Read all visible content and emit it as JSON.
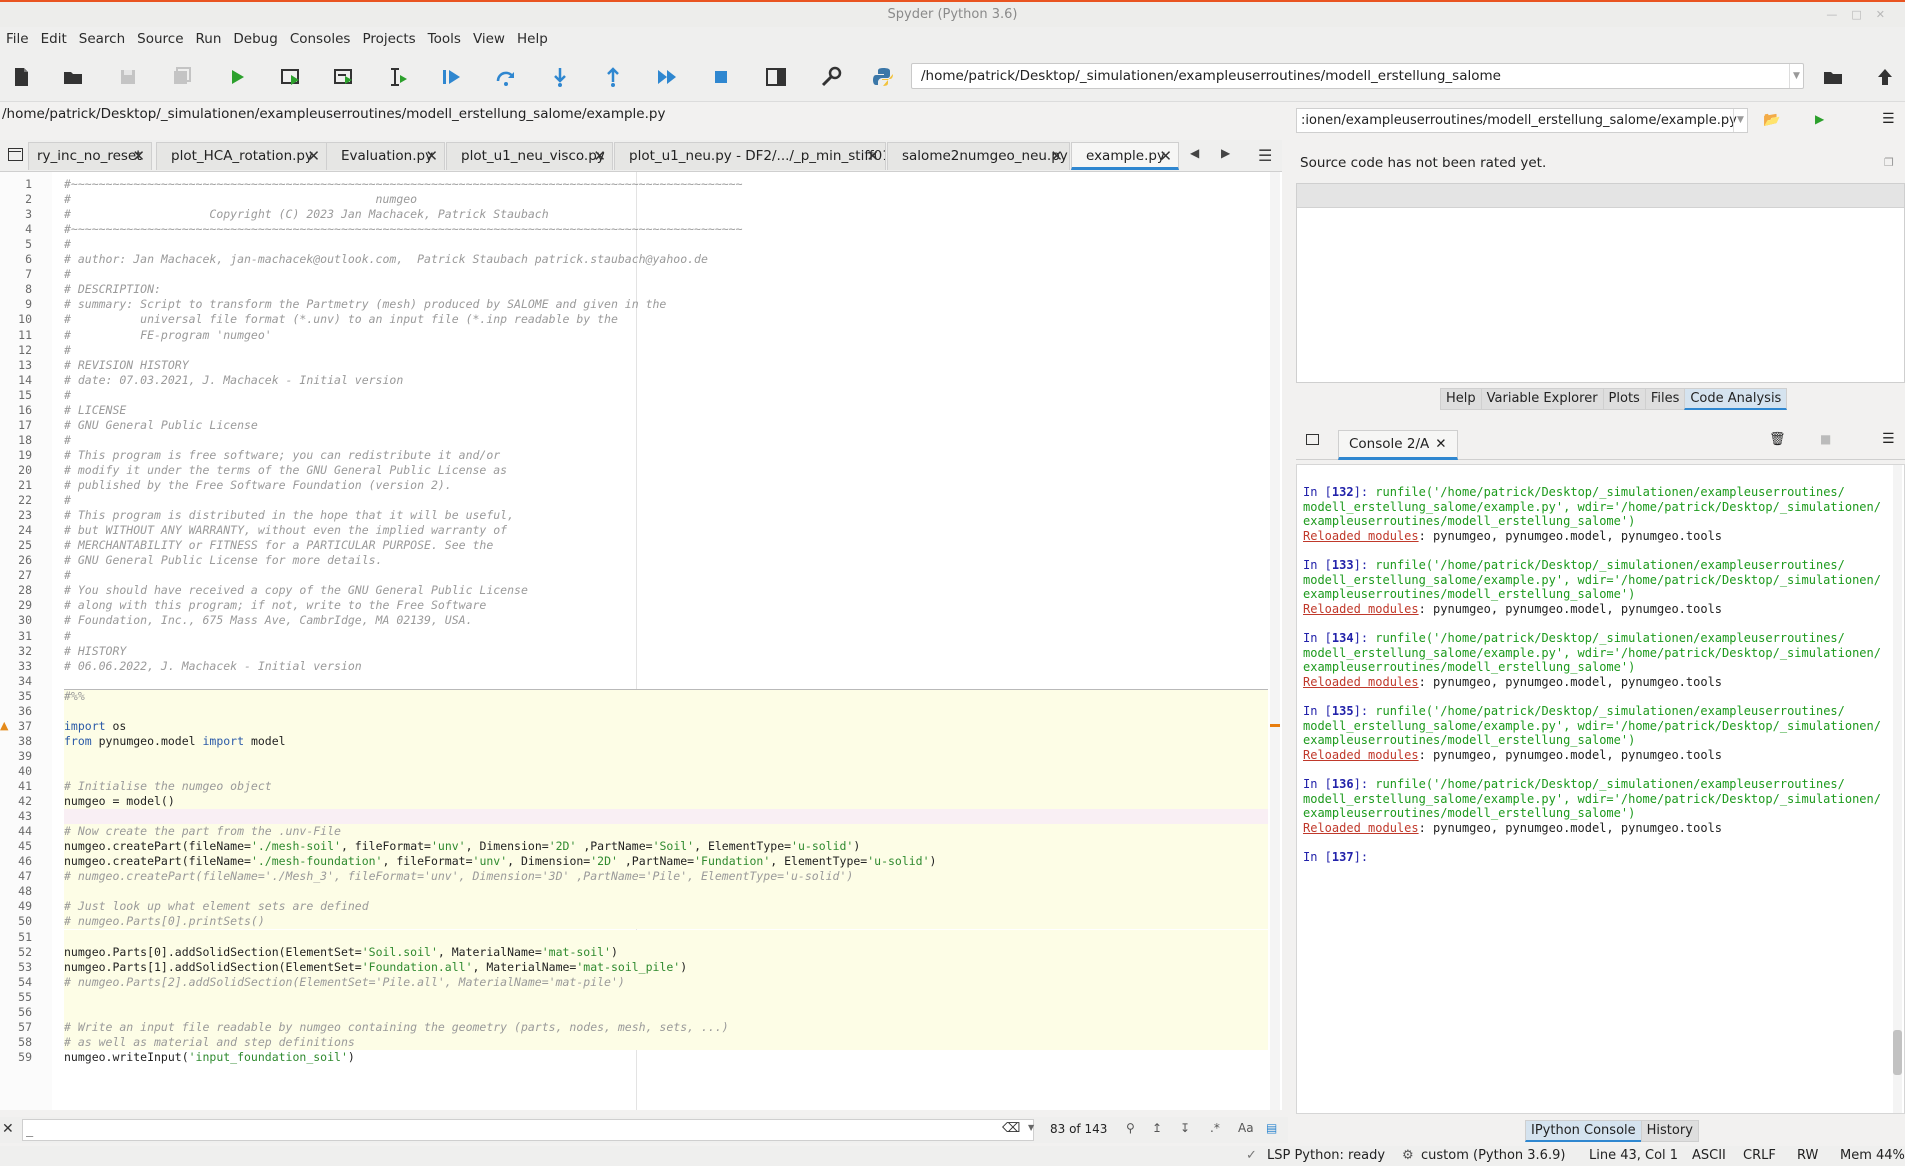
{
  "window": {
    "title": "Spyder (Python 3.6)"
  },
  "menu": [
    "File",
    "Edit",
    "Search",
    "Source",
    "Run",
    "Debug",
    "Consoles",
    "Projects",
    "Tools",
    "View",
    "Help"
  ],
  "toolbar": {
    "working_dir": "/home/patrick/Desktop/_simulationen/exampleuserroutines/modell_erstellung_salome",
    "icons": [
      "new-file-icon",
      "open-file-icon",
      "save-icon",
      "save-all-icon",
      "run-icon",
      "run-cell-icon",
      "run-cell-advance-icon",
      "run-selection-icon",
      "debug-icon",
      "step-icon",
      "step-into-icon",
      "step-return-icon",
      "continue-icon",
      "stop-icon",
      "maximize-pane-icon",
      "preferences-icon",
      "python-path-icon",
      "browse-folder-icon",
      "parent-dir-icon"
    ]
  },
  "editor": {
    "filepath": "/home/patrick/Desktop/_simulationen/exampleuserroutines/modell_erstellung_salome/example.py",
    "tabs": [
      {
        "label": "ry_inc_no_reset",
        "active": false
      },
      {
        "label": "plot_HCA_rotation.py",
        "active": false
      },
      {
        "label": "Evaluation.py",
        "active": false
      },
      {
        "label": "plot_u1_neu_visco.py",
        "active": false
      },
      {
        "label": "plot_u1_neu.py - DF2/.../_p_min_stiff01",
        "active": false
      },
      {
        "label": "salome2numgeo_neu.py",
        "active": false
      },
      {
        "label": "example.py",
        "active": true
      }
    ],
    "lines": [
      {
        "n": 1,
        "t": "c",
        "s": "#~~~~~~~~~~~~~~~~~~~~~~~~~~~~~~~~~~~~~~~~~~~~~~~~~~~~~~~~~~~~~~~~~~~~~~~~~~~~~~~~~~~~~~~~~~~~~~~~~"
      },
      {
        "n": 2,
        "t": "c",
        "s": "#                                            numgeo"
      },
      {
        "n": 3,
        "t": "c",
        "s": "#                    Copyright (C) 2023 Jan Machacek, Patrick Staubach"
      },
      {
        "n": 4,
        "t": "c",
        "s": "#~~~~~~~~~~~~~~~~~~~~~~~~~~~~~~~~~~~~~~~~~~~~~~~~~~~~~~~~~~~~~~~~~~~~~~~~~~~~~~~~~~~~~~~~~~~~~~~~~"
      },
      {
        "n": 5,
        "t": "c",
        "s": "#"
      },
      {
        "n": 6,
        "t": "c",
        "s": "# author: Jan Machacek, jan-machacek@outlook.com,  Patrick Staubach patrick.staubach@yahoo.de"
      },
      {
        "n": 7,
        "t": "c",
        "s": "#"
      },
      {
        "n": 8,
        "t": "c",
        "s": "# DESCRIPTION:"
      },
      {
        "n": 9,
        "t": "c",
        "s": "# summary: Script to transform the Partmetry (mesh) produced by SALOME and given in the"
      },
      {
        "n": 10,
        "t": "c",
        "s": "#          universal file format (*.unv) to an input file (*.inp readable by the"
      },
      {
        "n": 11,
        "t": "c",
        "s": "#          FE-program 'numgeo'"
      },
      {
        "n": 12,
        "t": "c",
        "s": "#"
      },
      {
        "n": 13,
        "t": "c",
        "s": "# REVISION HISTORY"
      },
      {
        "n": 14,
        "t": "c",
        "s": "# date: 07.03.2021, J. Machacek - Initial version"
      },
      {
        "n": 15,
        "t": "c",
        "s": "#"
      },
      {
        "n": 16,
        "t": "c",
        "s": "# LICENSE"
      },
      {
        "n": 17,
        "t": "c",
        "s": "# GNU General Public License"
      },
      {
        "n": 18,
        "t": "c",
        "s": "#"
      },
      {
        "n": 19,
        "t": "c",
        "s": "# This program is free software; you can redistribute it and/or"
      },
      {
        "n": 20,
        "t": "c",
        "s": "# modify it under the terms of the GNU General Public License as"
      },
      {
        "n": 21,
        "t": "c",
        "s": "# published by the Free Software Foundation (version 2)."
      },
      {
        "n": 22,
        "t": "c",
        "s": "#"
      },
      {
        "n": 23,
        "t": "c",
        "s": "# This program is distributed in the hope that it will be useful,"
      },
      {
        "n": 24,
        "t": "c",
        "s": "# but WITHOUT ANY WARRANTY, without even the implied warranty of"
      },
      {
        "n": 25,
        "t": "c",
        "s": "# MERCHANTABILITY or FITNESS for a PARTICULAR PURPOSE. See the"
      },
      {
        "n": 26,
        "t": "c",
        "s": "# GNU General Public License for more details."
      },
      {
        "n": 27,
        "t": "c",
        "s": "#"
      },
      {
        "n": 28,
        "t": "c",
        "s": "# You should have received a copy of the GNU General Public License"
      },
      {
        "n": 29,
        "t": "c",
        "s": "# along with this program; if not, write to the Free Software"
      },
      {
        "n": 30,
        "t": "c",
        "s": "# Foundation, Inc., 675 Mass Ave, CambrIdge, MA 02139, USA."
      },
      {
        "n": 31,
        "t": "c",
        "s": "#"
      },
      {
        "n": 32,
        "t": "c",
        "s": "# HISTORY"
      },
      {
        "n": 33,
        "t": "c",
        "s": "# 06.06.2022, J. Machacek - Initial version"
      },
      {
        "n": 34,
        "t": "p",
        "s": ""
      },
      {
        "n": 35,
        "t": "c",
        "s": "#%%",
        "cell": true
      },
      {
        "n": 36,
        "t": "p",
        "s": "",
        "cell": true
      },
      {
        "n": 37,
        "t": "x",
        "cell": true,
        "parts": [
          [
            "kw",
            "import"
          ],
          [
            "pl",
            " os"
          ]
        ]
      },
      {
        "n": 38,
        "t": "x",
        "cell": true,
        "parts": [
          [
            "kw",
            "from"
          ],
          [
            "pl",
            " pynumgeo.model "
          ],
          [
            "kw",
            "import"
          ],
          [
            "pl",
            " model"
          ]
        ]
      },
      {
        "n": 39,
        "t": "p",
        "s": "",
        "cell": true
      },
      {
        "n": 40,
        "t": "p",
        "s": "",
        "cell": true
      },
      {
        "n": 41,
        "t": "c",
        "s": "# Initialise the numgeo object",
        "cell": true
      },
      {
        "n": 42,
        "t": "p",
        "s": "numgeo = model()",
        "cell": true
      },
      {
        "n": 43,
        "t": "p",
        "s": "",
        "cur": true
      },
      {
        "n": 44,
        "t": "c",
        "s": "# Now create the part from the .unv-File",
        "cell": true
      },
      {
        "n": 45,
        "t": "x",
        "cell": true,
        "parts": [
          [
            "pl",
            "numgeo.createPart(fileName="
          ],
          [
            "st",
            "'./mesh-soil'"
          ],
          [
            "pl",
            ", fileFormat="
          ],
          [
            "st",
            "'unv'"
          ],
          [
            "pl",
            ", Dimension="
          ],
          [
            "st",
            "'2D'"
          ],
          [
            "pl",
            " ,PartName="
          ],
          [
            "st",
            "'Soil'"
          ],
          [
            "pl",
            ", ElementType="
          ],
          [
            "st",
            "'u-solid'"
          ],
          [
            "pl",
            ")"
          ]
        ]
      },
      {
        "n": 46,
        "t": "x",
        "cell": true,
        "parts": [
          [
            "pl",
            "numgeo.createPart(fileName="
          ],
          [
            "st",
            "'./mesh-foundation'"
          ],
          [
            "pl",
            ", fileFormat="
          ],
          [
            "st",
            "'unv'"
          ],
          [
            "pl",
            ", Dimension="
          ],
          [
            "st",
            "'2D'"
          ],
          [
            "pl",
            " ,PartName="
          ],
          [
            "st",
            "'Fundation'"
          ],
          [
            "pl",
            ", ElementType="
          ],
          [
            "st",
            "'u-solid'"
          ],
          [
            "pl",
            ")"
          ]
        ]
      },
      {
        "n": 47,
        "t": "c",
        "s": "# numgeo.createPart(fileName='./Mesh_3', fileFormat='unv', Dimension='3D' ,PartName='Pile', ElementType='u-solid')",
        "cell": true
      },
      {
        "n": 48,
        "t": "p",
        "s": "",
        "cell": true
      },
      {
        "n": 49,
        "t": "c",
        "s": "# Just look up what element sets are defined",
        "cell": true
      },
      {
        "n": 50,
        "t": "c",
        "s": "# numgeo.Parts[0].printSets()",
        "cell": true
      },
      {
        "n": 51,
        "t": "p",
        "s": "",
        "cell": true
      },
      {
        "n": 52,
        "t": "x",
        "cell": true,
        "parts": [
          [
            "pl",
            "numgeo.Parts[0].addSolidSection(ElementSet="
          ],
          [
            "st",
            "'Soil.soil'"
          ],
          [
            "pl",
            ", MaterialName="
          ],
          [
            "st",
            "'mat-soil'"
          ],
          [
            "pl",
            ")"
          ]
        ]
      },
      {
        "n": 53,
        "t": "x",
        "cell": true,
        "parts": [
          [
            "pl",
            "numgeo.Parts[1].addSolidSection(ElementSet="
          ],
          [
            "st",
            "'Foundation.all'"
          ],
          [
            "pl",
            ", MaterialName="
          ],
          [
            "st",
            "'mat-soil_pile'"
          ],
          [
            "pl",
            ")"
          ]
        ]
      },
      {
        "n": 54,
        "t": "c",
        "s": "# numgeo.Parts[2].addSolidSection(ElementSet='Pile.all', MaterialName='mat-pile')",
        "cell": true
      },
      {
        "n": 55,
        "t": "p",
        "s": "",
        "cell": true
      },
      {
        "n": 56,
        "t": "p",
        "s": "",
        "cell": true
      },
      {
        "n": 57,
        "t": "c",
        "s": "# Write an input file readable by numgeo containing the geometry (parts, nodes, mesh, sets, ...)",
        "cell": true
      },
      {
        "n": 58,
        "t": "c",
        "s": "# as well as material and step definitions",
        "cell": true
      },
      {
        "n": 59,
        "t": "x",
        "parts": [
          [
            "pl",
            "numgeo.writeInput("
          ],
          [
            "st",
            "'input_foundation_soil'"
          ],
          [
            "pl",
            ")"
          ]
        ]
      }
    ]
  },
  "find": {
    "value": "_",
    "count": "83 of 143"
  },
  "code_analysis": {
    "file": ":ionen/exampleuserroutines/modell_erstellung_salome/example.py",
    "rating": "Source code has not been rated yet."
  },
  "pane_tabs_top": [
    {
      "label": "Help",
      "active": false
    },
    {
      "label": "Variable Explorer",
      "active": false
    },
    {
      "label": "Plots",
      "active": false
    },
    {
      "label": "Files",
      "active": false
    },
    {
      "label": "Code Analysis",
      "active": true
    }
  ],
  "console": {
    "tab": "Console 2/A",
    "entries": [
      {
        "num": "132",
        "l1": "runfile('/home/patrick/Desktop/_simulationen/exampleuserroutines/",
        "l2": "modell_erstellung_salome/example.py', wdir='/home/patrick/Desktop/_simulationen/",
        "l3": "exampleuserroutines/modell_erstellung_salome')",
        "reload_label": "Reloaded modules",
        "reload": ": pynumgeo, pynumgeo.model, pynumgeo.tools"
      },
      {
        "num": "133",
        "l1": "runfile('/home/patrick/Desktop/_simulationen/exampleuserroutines/",
        "l2": "modell_erstellung_salome/example.py', wdir='/home/patrick/Desktop/_simulationen/",
        "l3": "exampleuserroutines/modell_erstellung_salome')",
        "reload_label": "Reloaded modules",
        "reload": ": pynumgeo, pynumgeo.model, pynumgeo.tools"
      },
      {
        "num": "134",
        "l1": "runfile('/home/patrick/Desktop/_simulationen/exampleuserroutines/",
        "l2": "modell_erstellung_salome/example.py', wdir='/home/patrick/Desktop/_simulationen/",
        "l3": "exampleuserroutines/modell_erstellung_salome')",
        "reload_label": "Reloaded modules",
        "reload": ": pynumgeo, pynumgeo.model, pynumgeo.tools"
      },
      {
        "num": "135",
        "l1": "runfile('/home/patrick/Desktop/_simulationen/exampleuserroutines/",
        "l2": "modell_erstellung_salome/example.py', wdir='/home/patrick/Desktop/_simulationen/",
        "l3": "exampleuserroutines/modell_erstellung_salome')",
        "reload_label": "Reloaded modules",
        "reload": ": pynumgeo, pynumgeo.model, pynumgeo.tools"
      },
      {
        "num": "136",
        "l1": "runfile('/home/patrick/Desktop/_simulationen/exampleuserroutines/",
        "l2": "modell_erstellung_salome/example.py', wdir='/home/patrick/Desktop/_simulationen/",
        "l3": "exampleuserroutines/modell_erstellung_salome')",
        "reload_label": "Reloaded modules",
        "reload": ": pynumgeo, pynumgeo.model, pynumgeo.tools"
      }
    ],
    "prompt_num": "137"
  },
  "pane_tabs_bottom": [
    {
      "label": "IPython Console",
      "active": true
    },
    {
      "label": "History",
      "active": false
    }
  ],
  "status": {
    "lsp": "LSP Python: ready",
    "env": "custom (Python 3.6.9)",
    "cursor": "Line 43, Col 1",
    "encoding": "ASCII",
    "eol": "CRLF",
    "rw": "RW",
    "mem": "Mem 44%"
  },
  "colors": {
    "accent": "#2f87d0",
    "orange": "#e95420"
  }
}
